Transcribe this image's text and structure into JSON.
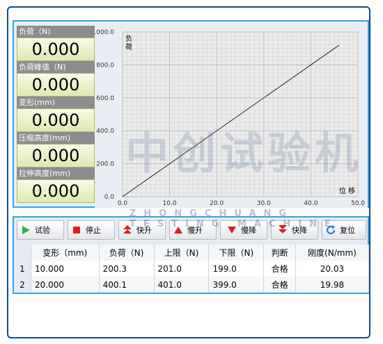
{
  "readouts": [
    {
      "label": "负荷（N)",
      "value": "0.000"
    },
    {
      "label": "负荷峰值（N)",
      "value": "0.000"
    },
    {
      "label": "变形(mm)",
      "value": "0.000"
    },
    {
      "label": "压缩高度(mm)",
      "value": "0.000"
    },
    {
      "label": "拉伸高度(mm)",
      "value": "0.000"
    }
  ],
  "chart_data": {
    "type": "line",
    "ylabel": "负荷",
    "xlabel": "位 移",
    "xlim": [
      0,
      50
    ],
    "ylim": [
      0,
      1000
    ],
    "x_ticks": [
      "0.0",
      "10.0",
      "20.0",
      "30.0",
      "40.0",
      "50.0"
    ],
    "y_ticks": [
      "0.0",
      "200.0",
      "400.0",
      "600.0",
      "800.0",
      "1000.0"
    ],
    "grid": true,
    "series": [
      {
        "x": [
          0,
          46
        ],
        "y": [
          0,
          920
        ]
      }
    ]
  },
  "toolbar": [
    {
      "label": "试验",
      "icon": "play-icon",
      "color": "#2bb33c"
    },
    {
      "label": "停止",
      "icon": "stop-icon",
      "color": "#e02020"
    },
    {
      "label": "快升",
      "icon": "double-up-icon",
      "color": "#d42020"
    },
    {
      "label": "慢升",
      "icon": "up-icon",
      "color": "#d42020"
    },
    {
      "label": "慢降",
      "icon": "down-icon",
      "color": "#d42020"
    },
    {
      "label": "快降",
      "icon": "double-down-icon",
      "color": "#d42020"
    },
    {
      "label": "复位",
      "icon": "refresh-icon",
      "color": "#2f7fd1"
    }
  ],
  "table": {
    "headers": [
      "",
      "变形（mm)",
      "负荷（N)",
      "上限（N)",
      "下限（N)",
      "判断",
      "刚度(N/mm)"
    ],
    "rows": [
      [
        "1",
        "10.000",
        "200.3",
        "201.0",
        "199.0",
        "合格",
        "20.03"
      ],
      [
        "2",
        "20.000",
        "400.1",
        "401.0",
        "399.0",
        "合格",
        "19.98"
      ]
    ]
  },
  "watermark": {
    "main": "中创试验机",
    "sub": "ZHONGCHUANG TESTING MACHINE"
  }
}
